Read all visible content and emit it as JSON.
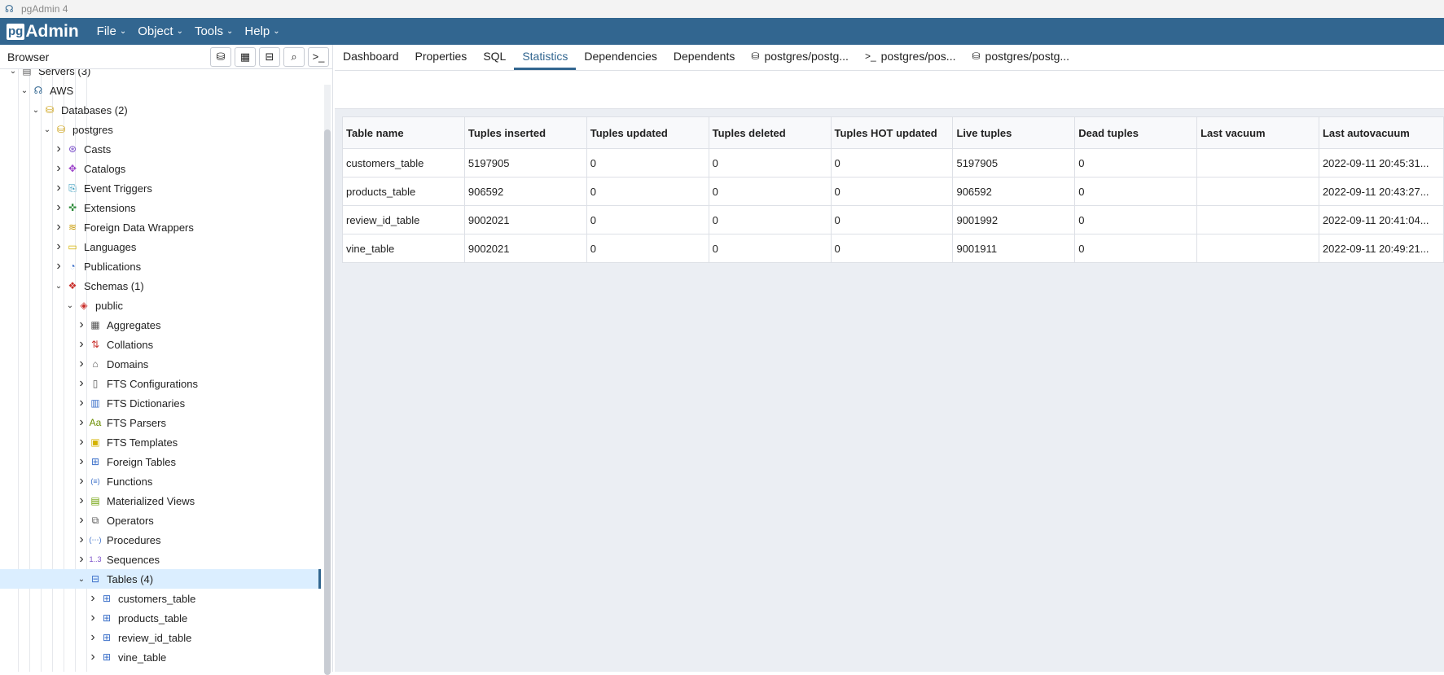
{
  "window": {
    "title": "pgAdmin 4"
  },
  "menubar": {
    "logo_pg": "pg",
    "logo_text": "Admin",
    "items": [
      {
        "label": "File"
      },
      {
        "label": "Object"
      },
      {
        "label": "Tools"
      },
      {
        "label": "Help"
      }
    ]
  },
  "browser": {
    "title": "Browser",
    "tree": [
      {
        "label": "Servers (3)",
        "indent": 0,
        "expanded": true,
        "icon": "servers-icon",
        "glyph": "▤",
        "color": "#666"
      },
      {
        "label": "AWS",
        "indent": 1,
        "expanded": true,
        "icon": "server-icon",
        "glyph": "☊",
        "color": "#336791"
      },
      {
        "label": "Databases (2)",
        "indent": 2,
        "expanded": true,
        "icon": "databases-icon",
        "glyph": "⛁",
        "color": "#c99a00"
      },
      {
        "label": "postgres",
        "indent": 3,
        "expanded": true,
        "icon": "database-icon",
        "glyph": "⛁",
        "color": "#c99a00"
      },
      {
        "label": "Casts",
        "indent": 4,
        "expanded": false,
        "icon": "casts-icon",
        "glyph": "⊛",
        "color": "#7a4fc9"
      },
      {
        "label": "Catalogs",
        "indent": 4,
        "expanded": false,
        "icon": "catalogs-icon",
        "glyph": "✥",
        "color": "#9b3fc9"
      },
      {
        "label": "Event Triggers",
        "indent": 4,
        "expanded": false,
        "icon": "event-triggers-icon",
        "glyph": "⎘",
        "color": "#1f8fb5"
      },
      {
        "label": "Extensions",
        "indent": 4,
        "expanded": false,
        "icon": "extensions-icon",
        "glyph": "✜",
        "color": "#2e8b3a"
      },
      {
        "label": "Foreign Data Wrappers",
        "indent": 4,
        "expanded": false,
        "icon": "foreign-data-wrappers-icon",
        "glyph": "≋",
        "color": "#c99a00"
      },
      {
        "label": "Languages",
        "indent": 4,
        "expanded": false,
        "icon": "languages-icon",
        "glyph": "▭",
        "color": "#d4b300"
      },
      {
        "label": "Publications",
        "indent": 4,
        "expanded": false,
        "icon": "publications-icon",
        "glyph": "◔",
        "color": "#3b6fc9"
      },
      {
        "label": "Schemas (1)",
        "indent": 4,
        "expanded": true,
        "icon": "schemas-icon",
        "glyph": "❖",
        "color": "#c9302c"
      },
      {
        "label": "public",
        "indent": 5,
        "expanded": true,
        "icon": "schema-icon",
        "glyph": "◈",
        "color": "#c9302c"
      },
      {
        "label": "Aggregates",
        "indent": 6,
        "expanded": false,
        "icon": "aggregates-icon",
        "glyph": "▦",
        "color": "#555"
      },
      {
        "label": "Collations",
        "indent": 6,
        "expanded": false,
        "icon": "collations-icon",
        "glyph": "⇅",
        "color": "#c9302c"
      },
      {
        "label": "Domains",
        "indent": 6,
        "expanded": false,
        "icon": "domains-icon",
        "glyph": "⌂",
        "color": "#555"
      },
      {
        "label": "FTS Configurations",
        "indent": 6,
        "expanded": false,
        "icon": "fts-configurations-icon",
        "glyph": "▯",
        "color": "#555"
      },
      {
        "label": "FTS Dictionaries",
        "indent": 6,
        "expanded": false,
        "icon": "fts-dictionaries-icon",
        "glyph": "▥",
        "color": "#3b6fc9"
      },
      {
        "label": "FTS Parsers",
        "indent": 6,
        "expanded": false,
        "icon": "fts-parsers-icon",
        "glyph": "Aa",
        "color": "#6b8e00"
      },
      {
        "label": "FTS Templates",
        "indent": 6,
        "expanded": false,
        "icon": "fts-templates-icon",
        "glyph": "▣",
        "color": "#d4b300"
      },
      {
        "label": "Foreign Tables",
        "indent": 6,
        "expanded": false,
        "icon": "foreign-tables-icon",
        "glyph": "⊞",
        "color": "#3b6fc9"
      },
      {
        "label": "Functions",
        "indent": 6,
        "expanded": false,
        "icon": "functions-icon",
        "glyph": "(≡)",
        "color": "#3b6fc9"
      },
      {
        "label": "Materialized Views",
        "indent": 6,
        "expanded": false,
        "icon": "materialized-views-icon",
        "glyph": "▤",
        "color": "#6b9e00"
      },
      {
        "label": "Operators",
        "indent": 6,
        "expanded": false,
        "icon": "operators-icon",
        "glyph": "⧉",
        "color": "#555"
      },
      {
        "label": "Procedures",
        "indent": 6,
        "expanded": false,
        "icon": "procedures-icon",
        "glyph": "(⋯)",
        "color": "#3b6fc9"
      },
      {
        "label": "Sequences",
        "indent": 6,
        "expanded": false,
        "icon": "sequences-icon",
        "glyph": "1..3",
        "color": "#7a4fc9"
      },
      {
        "label": "Tables (4)",
        "indent": 6,
        "expanded": true,
        "selected": true,
        "icon": "tables-icon",
        "glyph": "⊟",
        "color": "#3b6fc9"
      },
      {
        "label": "customers_table",
        "indent": 7,
        "expanded": false,
        "icon": "table-icon",
        "glyph": "⊞",
        "color": "#3b6fc9"
      },
      {
        "label": "products_table",
        "indent": 7,
        "expanded": false,
        "icon": "table-icon",
        "glyph": "⊞",
        "color": "#3b6fc9"
      },
      {
        "label": "review_id_table",
        "indent": 7,
        "expanded": false,
        "icon": "table-icon",
        "glyph": "⊞",
        "color": "#3b6fc9"
      },
      {
        "label": "vine_table",
        "indent": 7,
        "expanded": false,
        "icon": "table-icon",
        "glyph": "⊞",
        "color": "#3b6fc9"
      }
    ]
  },
  "tabs": [
    {
      "label": "Dashboard",
      "active": false
    },
    {
      "label": "Properties",
      "active": false
    },
    {
      "label": "SQL",
      "active": false
    },
    {
      "label": "Statistics",
      "active": true
    },
    {
      "label": "Dependencies",
      "active": false
    },
    {
      "label": "Dependents",
      "active": false
    },
    {
      "label": "postgres/postg...",
      "active": false,
      "icon": "database-icon",
      "glyph": "⛁"
    },
    {
      "label": "postgres/pos...",
      "active": false,
      "icon": "terminal-icon",
      "glyph": ">_"
    },
    {
      "label": "postgres/postg...",
      "active": false,
      "icon": "database-icon",
      "glyph": "⛁"
    }
  ],
  "statistics": {
    "columns": [
      "Table name",
      "Tuples inserted",
      "Tuples updated",
      "Tuples deleted",
      "Tuples HOT updated",
      "Live tuples",
      "Dead tuples",
      "Last vacuum",
      "Last autovacuum"
    ],
    "rows": [
      [
        "customers_table",
        "5197905",
        "0",
        "0",
        "0",
        "5197905",
        "0",
        "",
        "2022-09-11 20:45:31..."
      ],
      [
        "products_table",
        "906592",
        "0",
        "0",
        "0",
        "906592",
        "0",
        "",
        "2022-09-11 20:43:27..."
      ],
      [
        "review_id_table",
        "9002021",
        "0",
        "0",
        "0",
        "9001992",
        "0",
        "",
        "2022-09-11 20:41:04..."
      ],
      [
        "vine_table",
        "9002021",
        "0",
        "0",
        "0",
        "9001911",
        "0",
        "",
        "2022-09-11 20:49:21..."
      ]
    ]
  }
}
